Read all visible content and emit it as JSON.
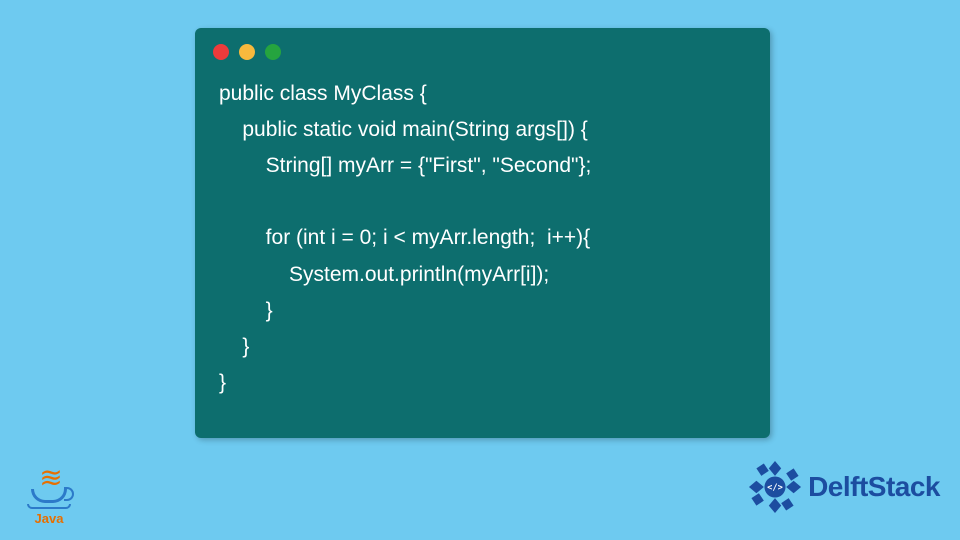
{
  "code_window": {
    "lines": [
      "public class MyClass {",
      "    public static void main(String args[]) {",
      "        String[] myArr = {\"First\", \"Second\"};",
      "",
      "        for (int i = 0; i < myArr.length;  i++){",
      "            System.out.println(myArr[i]);",
      "        }",
      "    }",
      "}"
    ],
    "window_colors": {
      "red": "#ed3b3b",
      "yellow": "#f7b93d",
      "green": "#25a43f",
      "bg": "#0d6e6e"
    }
  },
  "logos": {
    "java_label": "Java",
    "delft_label": "DelftStack"
  },
  "page_bg": "#6ecaf0"
}
